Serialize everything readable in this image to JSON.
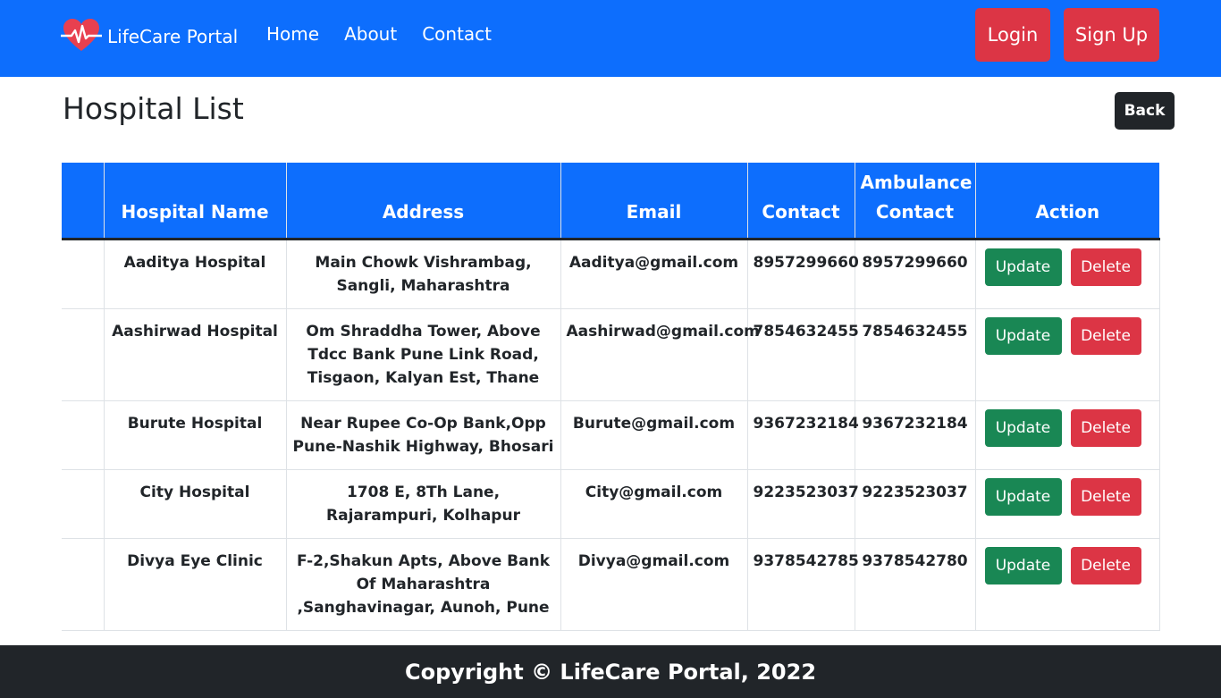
{
  "navbar": {
    "brand": "LifeCare Portal",
    "links": [
      "Home",
      "About",
      "Contact"
    ],
    "login_label": "Login",
    "signup_label": "Sign Up",
    "brand_icon": "heart-pulse-icon",
    "bg_color": "#0d6efd"
  },
  "page": {
    "title": "Hospital List",
    "back_label": "Back"
  },
  "table": {
    "headers": [
      "",
      "Hospital Name",
      "Address",
      "Email",
      "Contact",
      "Ambulance Contact",
      "Action"
    ],
    "rows": [
      {
        "name": "Aaditya Hospital",
        "address": "Main Chowk Vishrambag, Sangli, Maharashtra",
        "email": "Aaditya@gmail.com",
        "contact": "8957299660",
        "ambulance": "8957299660"
      },
      {
        "name": "Aashirwad Hospital",
        "address": "Om Shraddha Tower, Above Tdcc Bank Pune Link Road, Tisgaon, Kalyan Est, Thane",
        "email": "Aashirwad@gmail.com",
        "contact": "7854632455",
        "ambulance": "7854632455"
      },
      {
        "name": "Burute Hospital",
        "address": "Near Rupee Co-Op Bank,Opp Pune-Nashik Highway, Bhosari",
        "email": "Burute@gmail.com",
        "contact": "9367232184",
        "ambulance": "9367232184"
      },
      {
        "name": "City Hospital",
        "address": "1708 E, 8Th Lane, Rajarampuri, Kolhapur",
        "email": "City@gmail.com",
        "contact": "9223523037",
        "ambulance": "9223523037"
      },
      {
        "name": "Divya Eye Clinic",
        "address": "F-2,Shakun Apts, Above Bank Of Maharashtra ,Sanghavinagar, Aunoh, Pune",
        "email": "Divya@gmail.com",
        "contact": "9378542785",
        "ambulance": "9378542780"
      }
    ],
    "update_label": "Update",
    "delete_label": "Delete"
  },
  "footer": {
    "text": "Copyright © LifeCare Portal, 2022"
  },
  "colors": {
    "primary": "#0d6efd",
    "danger": "#dc3545",
    "success": "#198754",
    "dark": "#212529"
  }
}
